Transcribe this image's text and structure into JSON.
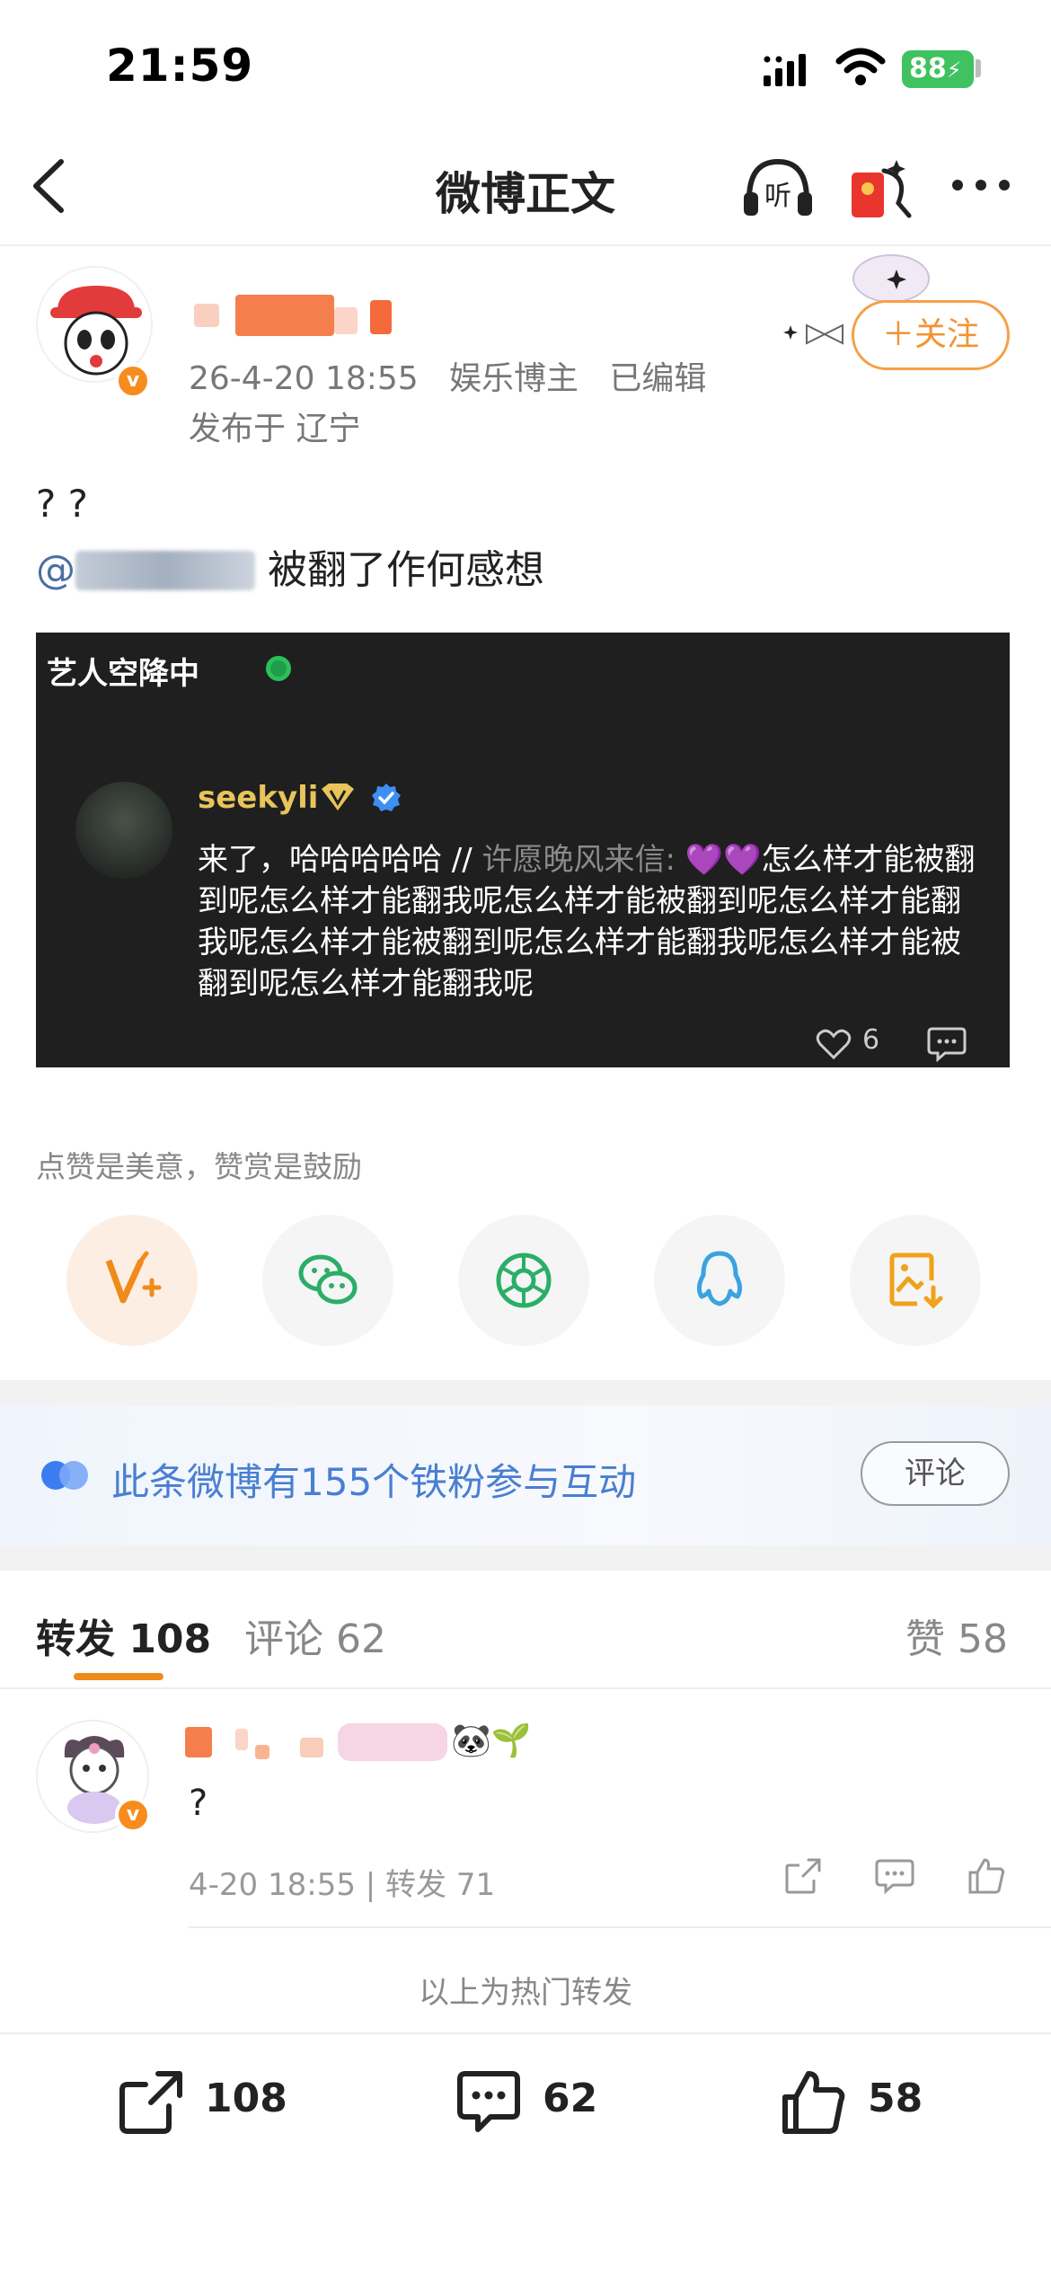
{
  "status_bar": {
    "time": "21:59",
    "battery": "88"
  },
  "nav": {
    "title": "微博正文",
    "listen_label": "听"
  },
  "author": {
    "date": "26-4-20 18:55",
    "tag": "娱乐博主",
    "edited": "已编辑",
    "location": "发布于 辽宁",
    "follow_label": "＋关注",
    "badge": "v"
  },
  "post": {
    "line1": "? ?",
    "mention_prefix": "@",
    "line2_suffix": "被翻了作何感想"
  },
  "embed": {
    "live_label": "艺人空降中",
    "user_name": "seekyli",
    "reply_text": "来了，哈哈哈哈哈 // ",
    "quoted_user": "许愿晚风来信: ",
    "hearts": "💜💜",
    "quoted_text": "怎么样才能被翻到呢怎么样才能翻我呢怎么样才能被翻到呢怎么样才能翻我呢怎么样才能被翻到呢怎么样才能翻我呢怎么样才能被翻到呢怎么样才能翻我呢",
    "like_count": "6"
  },
  "reward": {
    "text": "点赞是美意，赞赏是鼓励",
    "share_targets": [
      "reward-icon",
      "wechat-icon",
      "moments-icon",
      "qq-icon",
      "save-image-icon"
    ]
  },
  "fans": {
    "text": "此条微博有155个铁粉参与互动",
    "button": "评论"
  },
  "tabs": {
    "repost": "转发 108",
    "comment": "评论 62",
    "like": "赞 58"
  },
  "repost_item": {
    "text": "?",
    "meta": "4-20 18:55 | 转发 71",
    "emoji": "🐼🌱"
  },
  "hot_note": "以上为热门转发",
  "bottom_bar": {
    "repost_count": "108",
    "comment_count": "62",
    "like_count": "58"
  },
  "colors": {
    "accent_orange": "#f08a1a",
    "link_blue": "#4a7fd1",
    "embed_bg": "#1f1f1f"
  }
}
